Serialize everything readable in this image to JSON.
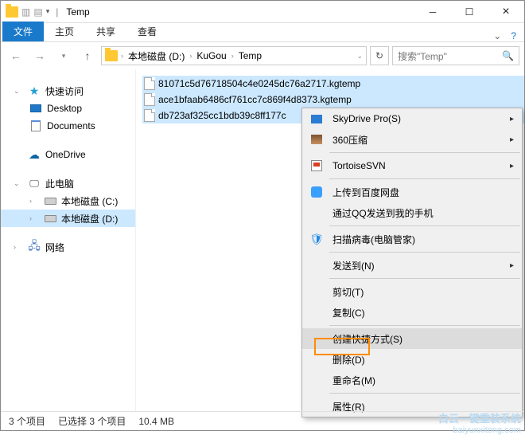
{
  "window": {
    "title": "Temp"
  },
  "ribbon": {
    "file": "文件",
    "tabs": [
      "主页",
      "共享",
      "查看"
    ]
  },
  "breadcrumb": {
    "segments": [
      "本地磁盘 (D:)",
      "KuGou",
      "Temp"
    ]
  },
  "search": {
    "placeholder": "搜索\"Temp\""
  },
  "nav": {
    "quick": "快速访问",
    "desktop": "Desktop",
    "documents": "Documents",
    "onedrive": "OneDrive",
    "thispc": "此电脑",
    "driveC": "本地磁盘 (C:)",
    "driveD": "本地磁盘 (D:)",
    "network": "网络"
  },
  "files": [
    "81071c5d76718504c4e0245dc76a2717.kgtemp",
    "ace1bfaab6486cf761cc7c869f4d8373.kgtemp",
    "db723af325cc1bdb39c8ff177c"
  ],
  "context": {
    "skydrive": "SkyDrive Pro(S)",
    "zip360": "360压缩",
    "svn": "TortoiseSVN",
    "baidu": "上传到百度网盘",
    "qq": "通过QQ发送到我的手机",
    "scan": "扫描病毒(电脑管家)",
    "sendto": "发送到(N)",
    "cut": "剪切(T)",
    "copy": "复制(C)",
    "shortcut": "创建快捷方式(S)",
    "delete": "删除(D)",
    "rename": "重命名(M)",
    "properties": "属性(R)"
  },
  "status": {
    "items": "3 个项目",
    "selected": "已选择 3 个项目",
    "size": "10.4 MB"
  },
  "watermark": {
    "line1": "白云一键重装系统",
    "line2": "baiyunxitong.com"
  }
}
